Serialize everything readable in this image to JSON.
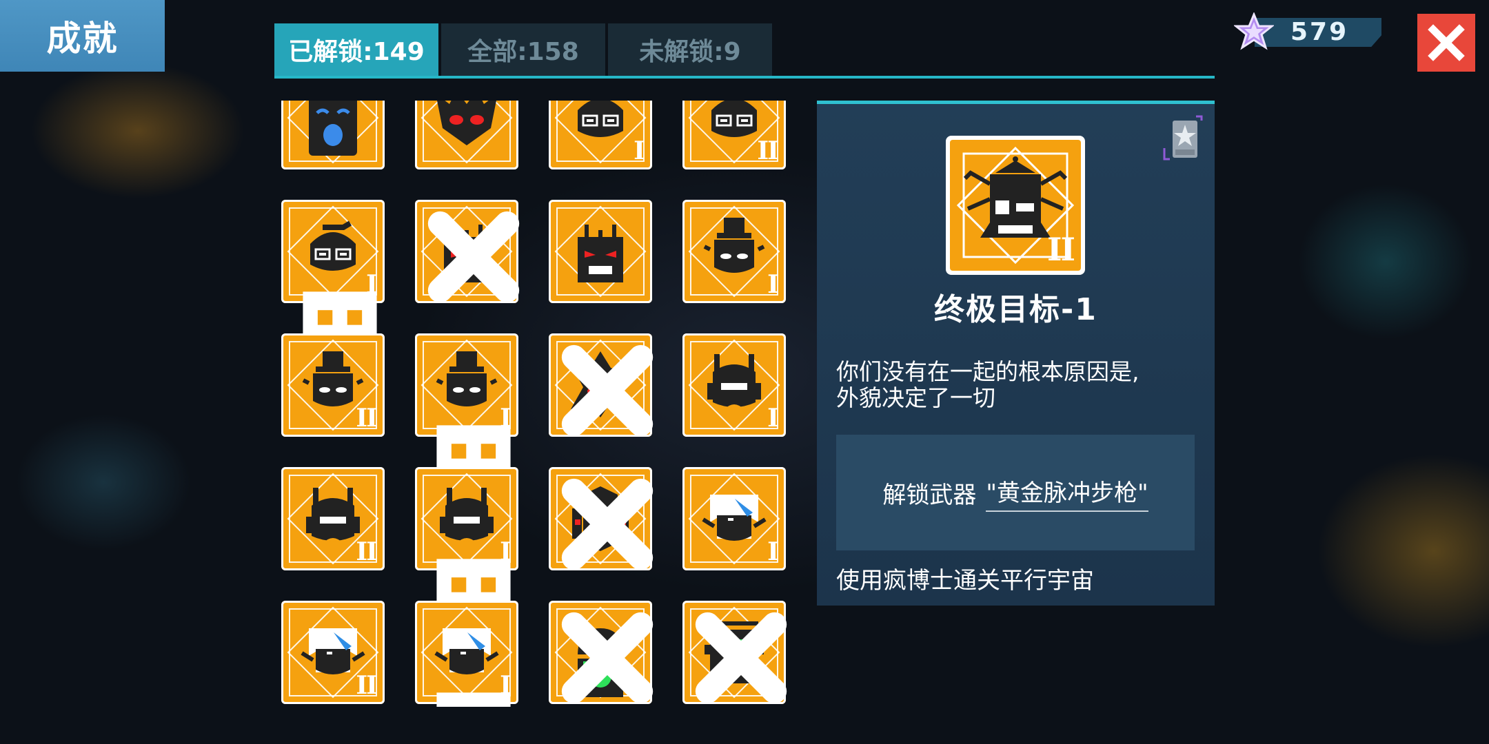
{
  "header": {
    "title": "成就"
  },
  "tabs": [
    {
      "label": "已解锁:149",
      "active": true
    },
    {
      "label": "全部:158",
      "active": false
    },
    {
      "label": "未解锁:9",
      "active": false
    }
  ],
  "currency": {
    "value": "579",
    "icon": "star-gem-icon"
  },
  "close": {
    "icon": "close-icon"
  },
  "grid": {
    "items": [
      {
        "rank": "",
        "locked": false,
        "skull": false
      },
      {
        "rank": "",
        "locked": false,
        "skull": false
      },
      {
        "rank": "I",
        "locked": false,
        "skull": false
      },
      {
        "rank": "II",
        "locked": false,
        "skull": false
      },
      {
        "rank": "I",
        "locked": false,
        "skull": true
      },
      {
        "rank": "",
        "locked": true,
        "skull": false
      },
      {
        "rank": "",
        "locked": false,
        "skull": false
      },
      {
        "rank": "I",
        "locked": false,
        "skull": false
      },
      {
        "rank": "II",
        "locked": false,
        "skull": false
      },
      {
        "rank": "I",
        "locked": false,
        "skull": true
      },
      {
        "rank": "",
        "locked": true,
        "skull": false
      },
      {
        "rank": "I",
        "locked": false,
        "skull": false
      },
      {
        "rank": "II",
        "locked": false,
        "skull": false
      },
      {
        "rank": "I",
        "locked": false,
        "skull": true
      },
      {
        "rank": "",
        "locked": true,
        "skull": false
      },
      {
        "rank": "I",
        "locked": false,
        "skull": false
      },
      {
        "rank": "II",
        "locked": false,
        "skull": false
      },
      {
        "rank": "I",
        "locked": false,
        "skull": true
      },
      {
        "rank": "",
        "locked": true,
        "skull": false
      },
      {
        "rank": "",
        "locked": true,
        "skull": false
      }
    ]
  },
  "detail": {
    "rank": "II",
    "title": "终极目标-1",
    "description_line1": "你们没有在一起的根本原因是,",
    "description_line2": "外貌决定了一切",
    "reward_prefix": "解锁武器",
    "reward_name": "\"黄金脉冲步枪\"",
    "condition": "使用疯博士通关平行宇宙"
  },
  "colors": {
    "accent": "#26b7c7",
    "tile": "#f5a10f",
    "close": "#e8473a",
    "panel": "#223e57"
  }
}
